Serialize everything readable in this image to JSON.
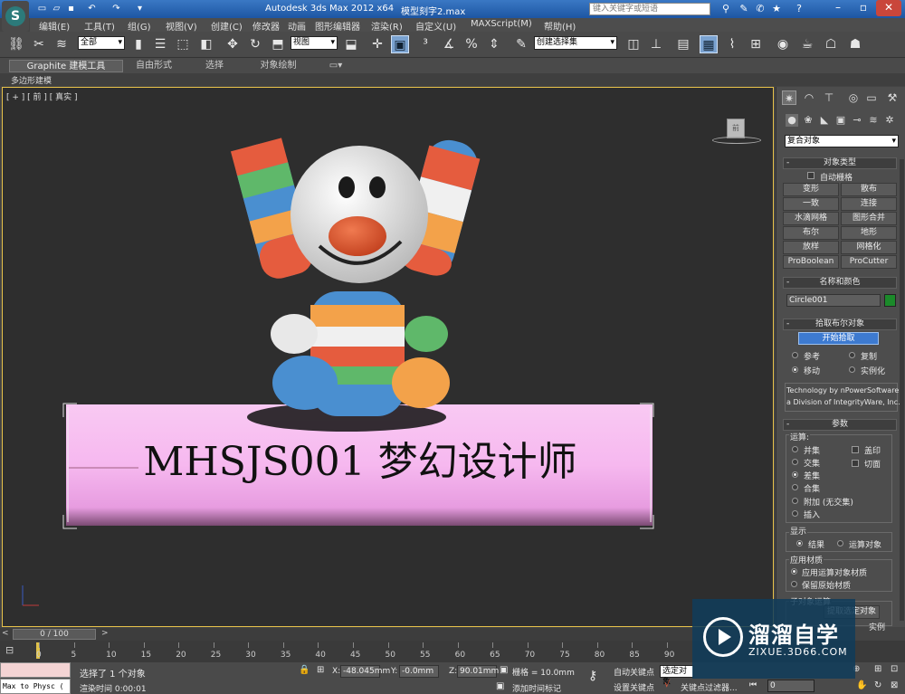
{
  "title_bar": {
    "app_title": "Autodesk 3ds Max  2012 x64",
    "file_name": "模型刻字2.max",
    "search_placeholder": "键入关键字或短语"
  },
  "menu": [
    "编辑(E)",
    "工具(T)",
    "组(G)",
    "视图(V)",
    "创建(C)",
    "修改器",
    "动画",
    "图形编辑器",
    "渲染(R)",
    "自定义(U)",
    "MAXScript(M)",
    "帮助(H)"
  ],
  "toolbar": {
    "selection_filter": "全部",
    "reference_coord": "视图",
    "named_selection": "创建选择集"
  },
  "ribbon": {
    "tabs": [
      "Graphite 建模工具",
      "自由形式",
      "选择",
      "对象绘制"
    ],
    "sub_label": "多边形建模"
  },
  "viewport": {
    "label": "[ + ] [ 前 ] [ 真实 ]",
    "viewcube_face": "前",
    "scene_text": "MHSJS001 梦幻设计师"
  },
  "command_panel": {
    "category": "复合对象",
    "object_type": {
      "title": "对象类型",
      "auto_grid": "自动栅格",
      "buttons": [
        "变形",
        "散布",
        "一致",
        "连接",
        "水滴网格",
        "图形合并",
        "布尔",
        "地形",
        "放样",
        "网格化",
        "ProBoolean",
        "ProCutter"
      ]
    },
    "name_color": {
      "title": "名称和颜色",
      "name": "Circle001",
      "color": "#1b8a2a"
    },
    "pick_boolean": {
      "title": "拾取布尔对象",
      "button": "开始拾取",
      "options": [
        "参考",
        "复制",
        "移动",
        "实例化"
      ],
      "selected": "移动"
    },
    "vendor": [
      "Technology by nPowerSoftware",
      "a Division of IntegrityWare, Inc."
    ],
    "parameters": {
      "title": "参数",
      "operation_label": "运算:",
      "operations": [
        "并集",
        "交集",
        "差集",
        "合集",
        "附加 (无交集)",
        "插入"
      ],
      "selected_operation": "差集",
      "checks": [
        "盖印",
        "切面"
      ],
      "display_label": "显示",
      "display_options": [
        "结果",
        "运算对象"
      ],
      "display_selected": "结果",
      "material_label": "应用材质",
      "material_options": [
        "应用运算对象材质",
        "保留原始材质"
      ],
      "material_selected": "应用运算对象材质",
      "sub_label": "子对象运算",
      "extract_button": "提取选定对象",
      "instance_label": "实例"
    }
  },
  "time": {
    "slider": "0 / 100",
    "ticks": [
      "0",
      "5",
      "10",
      "15",
      "20",
      "25",
      "30",
      "35",
      "40",
      "45",
      "50",
      "55",
      "60",
      "65",
      "70",
      "75",
      "80",
      "85",
      "90"
    ]
  },
  "status": {
    "maxscript": "Max to Physc (",
    "selection": "选择了 1 个对象",
    "render_time": "渲染时间  0:00:01",
    "x": "-48.045mm",
    "y": "-0.0mm",
    "z": "90.01mm",
    "grid": "栅格 = 10.0mm",
    "add_time_tag": "添加时间标记",
    "auto_key": "自动关键点",
    "key_mode": "选定对象",
    "set_key": "设置关键点",
    "key_filters": "关键点过滤器...",
    "frame": "0"
  },
  "watermark": {
    "name": "溜溜自学",
    "url": "ZIXUE.3D66.COM"
  }
}
